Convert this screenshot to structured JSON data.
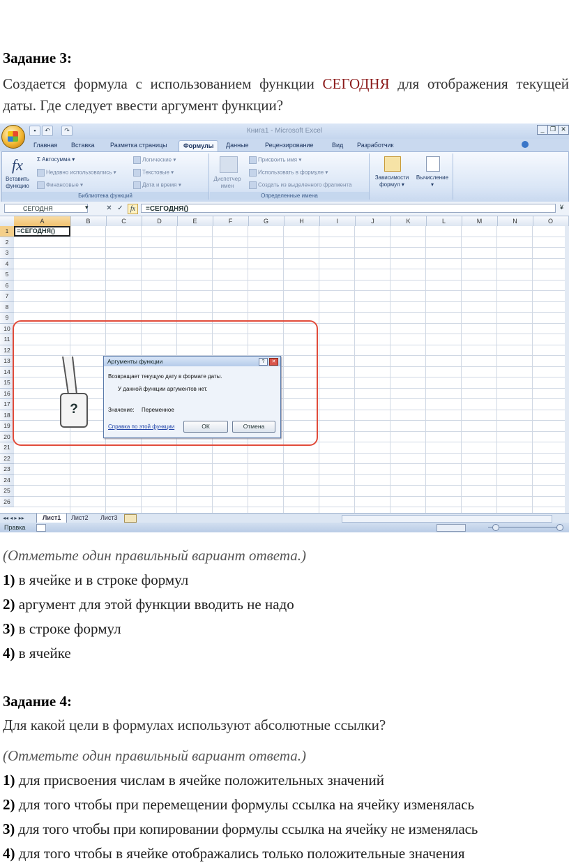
{
  "task3": {
    "title": "Задание 3:",
    "text_before": "Создается формула с использованием функции ",
    "highlight": "СЕГОДНЯ",
    "text_after": " для отображения текущей даты. Где следует ввести аргумент функции?",
    "hint": "(Отметьте один правильный вариант ответа.)",
    "options": [
      {
        "num": "1)",
        "text": " в ячейке и в строке формул"
      },
      {
        "num": "2)",
        "text": " аргумент для этой функции вводить не надо"
      },
      {
        "num": "3)",
        "text": " в строке формул"
      },
      {
        "num": "4)",
        "text": " в ячейке"
      }
    ]
  },
  "task4": {
    "title": "Задание 4:",
    "text": "Для какой цели в формулах используют абсолютные ссылки?",
    "hint": "(Отметьте один правильный вариант ответа.)",
    "options": [
      {
        "num": "1)",
        "text": " для присвоения числам в ячейке положительных значений"
      },
      {
        "num": "2)",
        "text": " для того чтобы при перемещении формулы ссылка на ячейку изменялась"
      },
      {
        "num": "3)",
        "text": " для того чтобы при копировании формулы ссылка на ячейку не изменялась"
      },
      {
        "num": "4)",
        "text": " для того чтобы в ячейке отображались только положительные значения"
      }
    ]
  },
  "excel": {
    "window_title": "Книга1 - Microsoft Excel",
    "tabs": [
      "Главная",
      "Вставка",
      "Разметка страницы",
      "Формулы",
      "Данные",
      "Рецензирование",
      "Вид",
      "Разработчик"
    ],
    "active_tab": "Формулы",
    "ribbon": {
      "insert_function": "Вставить функцию",
      "autosum": "Автосумма",
      "recent": "Недавно использовались",
      "financial": "Финансовые",
      "logical": "Логические",
      "text": "Текстовые",
      "datetime": "Дата и время",
      "group_library": "Библиотека функций",
      "name_manager": "Диспетчер имен",
      "assign_name": "Присвоить имя",
      "use_in_formula": "Использовать в формуле",
      "create_from_selection": "Создать из выделенного фрагмента",
      "group_names": "Определенные имена",
      "dependencies": "Зависимости формул",
      "calculation": "Вычисление"
    },
    "name_box": "СЕГОДНЯ",
    "formula": "=СЕГОДНЯ()",
    "fx": "fx",
    "columns": [
      "A",
      "B",
      "C",
      "D",
      "E",
      "F",
      "G",
      "H",
      "I",
      "J",
      "K",
      "L",
      "M",
      "N",
      "O"
    ],
    "rows": [
      "1",
      "2",
      "3",
      "4",
      "5",
      "6",
      "7",
      "8",
      "9",
      "10",
      "11",
      "12",
      "13",
      "14",
      "15",
      "16",
      "17",
      "18",
      "19",
      "20",
      "21",
      "22",
      "23",
      "24",
      "25",
      "26"
    ],
    "cell_a1": "=СЕГОДНЯ()",
    "dialog": {
      "title": "Аргументы функции",
      "desc": "Возвращает текущую дату в формате даты.",
      "no_args": "У данной функции аргументов нет.",
      "value_label": "Значение:",
      "value": "Переменное",
      "help_link": "Справка по этой функции",
      "ok": "ОК",
      "cancel": "Отмена"
    },
    "callout": "?",
    "sheets": [
      "Лист1",
      "Лист2",
      "Лист3"
    ],
    "status": "Правка"
  }
}
